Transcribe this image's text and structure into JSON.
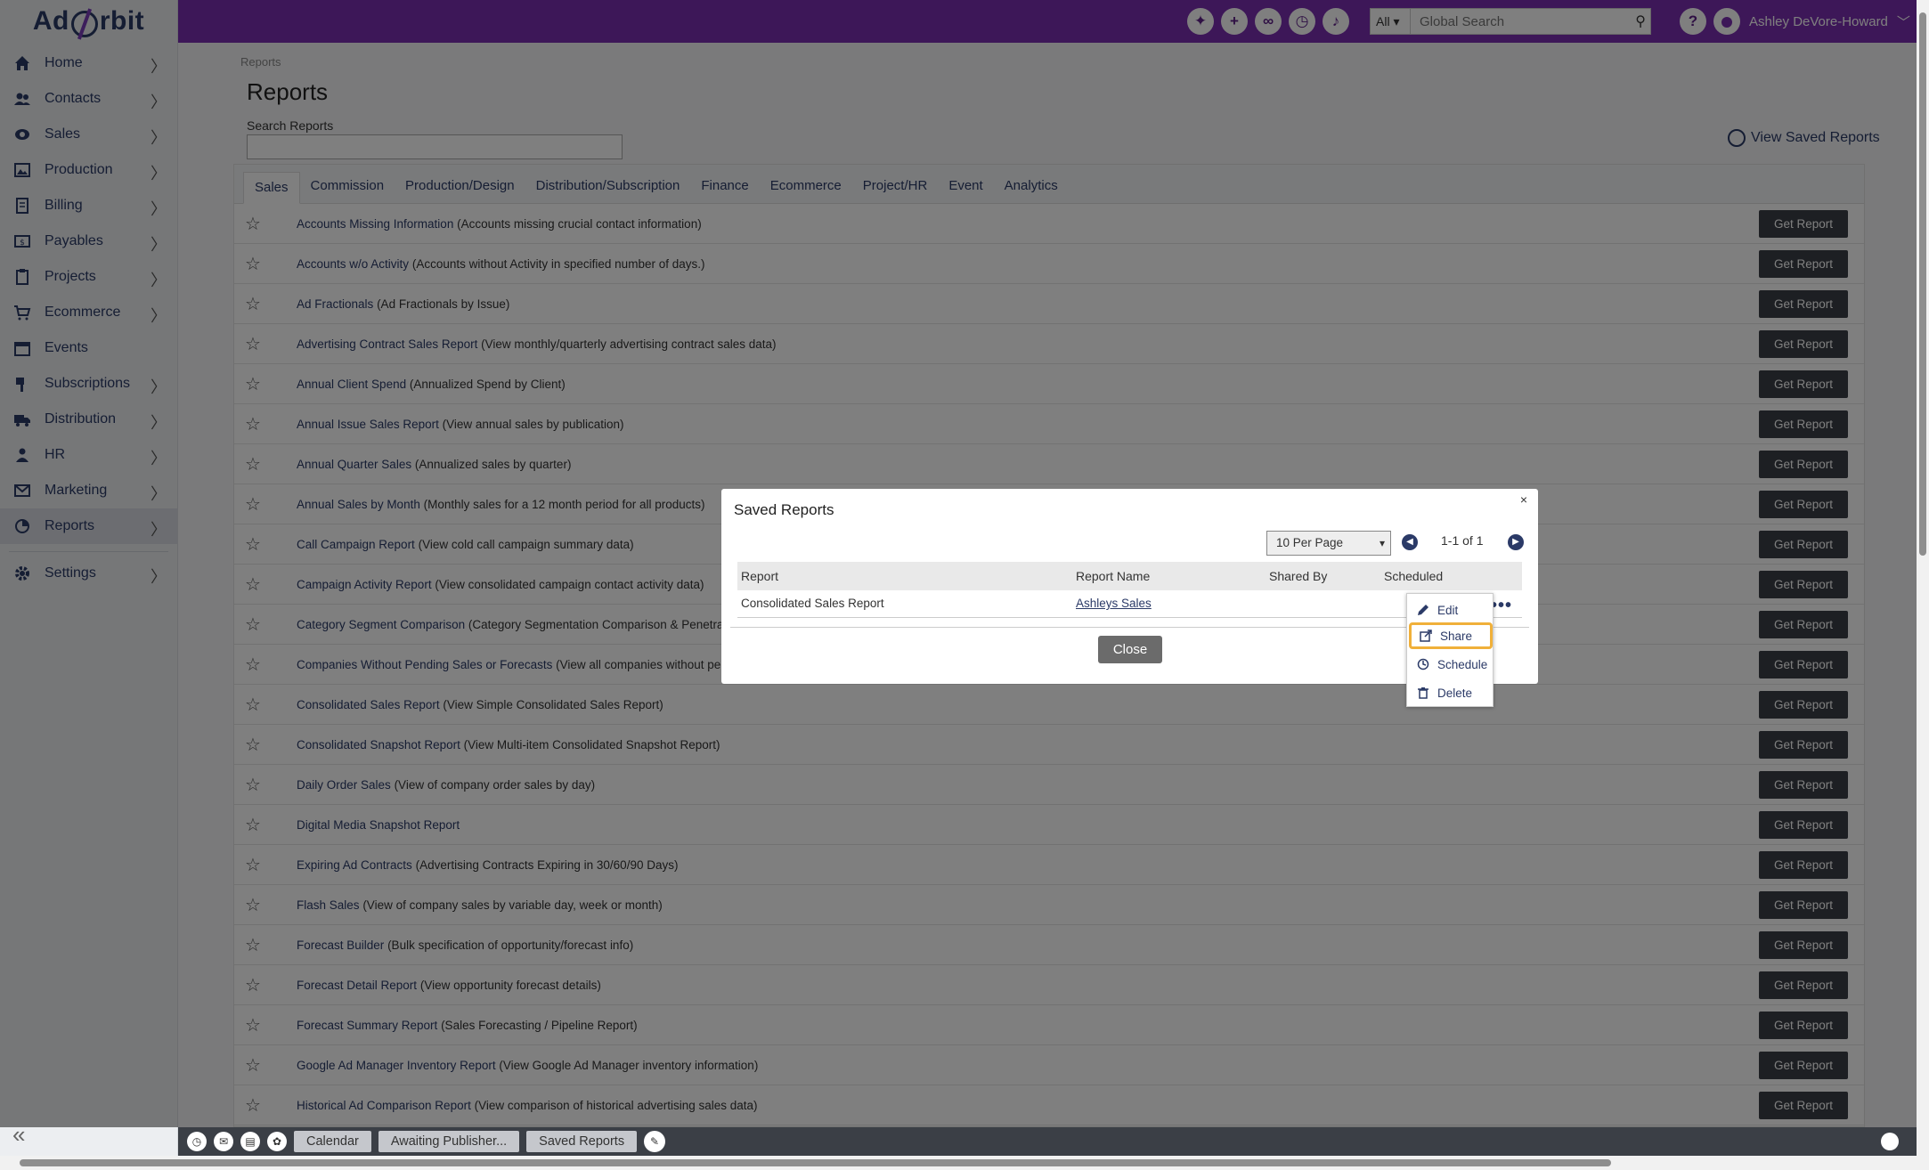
{
  "app": {
    "logo_text_a": "Ad",
    "logo_text_b": "rbit"
  },
  "sidebar": {
    "items": [
      {
        "label": "Home",
        "icon": "home-icon"
      },
      {
        "label": "Contacts",
        "icon": "contacts-icon"
      },
      {
        "label": "Sales",
        "icon": "sales-icon"
      },
      {
        "label": "Production",
        "icon": "production-icon"
      },
      {
        "label": "Billing",
        "icon": "billing-icon"
      },
      {
        "label": "Payables",
        "icon": "payables-icon"
      },
      {
        "label": "Projects",
        "icon": "projects-icon"
      },
      {
        "label": "Ecommerce",
        "icon": "cart-icon"
      },
      {
        "label": "Events",
        "icon": "calendar-icon"
      },
      {
        "label": "Subscriptions",
        "icon": "subscriptions-icon"
      },
      {
        "label": "Distribution",
        "icon": "truck-icon"
      },
      {
        "label": "HR",
        "icon": "hr-icon"
      },
      {
        "label": "Marketing",
        "icon": "mail-icon"
      },
      {
        "label": "Reports",
        "icon": "reports-icon"
      },
      {
        "label": "Settings",
        "icon": "gear-icon"
      }
    ]
  },
  "topbar": {
    "search_scope": "All",
    "search_placeholder": "Global Search",
    "user_name": "Ashley DeVore-Howard"
  },
  "page": {
    "breadcrumb": "Reports",
    "title": "Reports",
    "search_label": "Search Reports",
    "saved_link": "View Saved Reports",
    "tabs": [
      "Sales",
      "Commission",
      "Production/Design",
      "Distribution/Subscription",
      "Finance",
      "Ecommerce",
      "Project/HR",
      "Event",
      "Analytics"
    ],
    "get_report_label": "Get Report",
    "reports": [
      {
        "name": "Accounts Missing Information",
        "desc": "(Accounts missing crucial contact information)"
      },
      {
        "name": "Accounts w/o Activity",
        "desc": "(Accounts without Activity in specified number of days.)"
      },
      {
        "name": "Ad Fractionals",
        "desc": "(Ad Fractionals by Issue)"
      },
      {
        "name": "Advertising Contract Sales Report",
        "desc": "(View monthly/quarterly advertising contract sales data)"
      },
      {
        "name": "Annual Client Spend",
        "desc": "(Annualized Spend by Client)"
      },
      {
        "name": "Annual Issue Sales Report",
        "desc": "(View annual sales by publication)"
      },
      {
        "name": "Annual Quarter Sales",
        "desc": "(Annualized sales by quarter)"
      },
      {
        "name": "Annual Sales by Month",
        "desc": "(Monthly sales for a 12 month period for all products)"
      },
      {
        "name": "Call Campaign Report",
        "desc": "(View cold call campaign summary data)"
      },
      {
        "name": "Campaign Activity Report",
        "desc": "(View consolidated campaign contact activity data)"
      },
      {
        "name": "Category Segment Comparison",
        "desc": "(Category Segmentation Comparison & Penetratio"
      },
      {
        "name": "Companies Without Pending Sales or Forecasts",
        "desc": "(View all companies without pen"
      },
      {
        "name": "Consolidated Sales Report",
        "desc": "(View Simple Consolidated Sales Report)"
      },
      {
        "name": "Consolidated Snapshot Report",
        "desc": "(View Multi-item Consolidated Snapshot Report)"
      },
      {
        "name": "Daily Order Sales",
        "desc": "(View of company order sales by day)"
      },
      {
        "name": "Digital Media Snapshot Report",
        "desc": ""
      },
      {
        "name": "Expiring Ad Contracts",
        "desc": "(Advertising Contracts Expiring in 30/60/90 Days)"
      },
      {
        "name": "Flash Sales",
        "desc": "(View of company sales by variable day, week or month)"
      },
      {
        "name": "Forecast Builder",
        "desc": "(Bulk specification of opportunity/forecast info)"
      },
      {
        "name": "Forecast Detail Report",
        "desc": "(View opportunity forecast details)"
      },
      {
        "name": "Forecast Summary Report",
        "desc": "(Sales Forecasting / Pipeline Report)"
      },
      {
        "name": "Google Ad Manager Inventory Report",
        "desc": "(View Google Ad Manager inventory information)"
      },
      {
        "name": "Historical Ad Comparison Report",
        "desc": "(View comparison of historical advertising sales data)"
      }
    ]
  },
  "modal": {
    "title": "Saved Reports",
    "close_x": "×",
    "per_page": "10 Per Page",
    "pager_info": "1-1 of 1",
    "columns": [
      "Report",
      "Report Name",
      "Shared By",
      "Scheduled"
    ],
    "rows": [
      {
        "report": "Consolidated Sales Report",
        "report_name": "Ashleys Sales",
        "shared_by": "",
        "scheduled": ""
      }
    ],
    "close_label": "Close"
  },
  "action_menu": {
    "items": [
      {
        "label": "Edit",
        "icon": "pencil-icon"
      },
      {
        "label": "Share",
        "icon": "share-icon"
      },
      {
        "label": "Schedule",
        "icon": "clock-icon"
      },
      {
        "label": "Delete",
        "icon": "trash-icon"
      }
    ],
    "highlighted": "Share"
  },
  "bottombar": {
    "tabs": [
      "Calendar",
      "Awaiting Publisher...",
      "Saved Reports"
    ]
  }
}
